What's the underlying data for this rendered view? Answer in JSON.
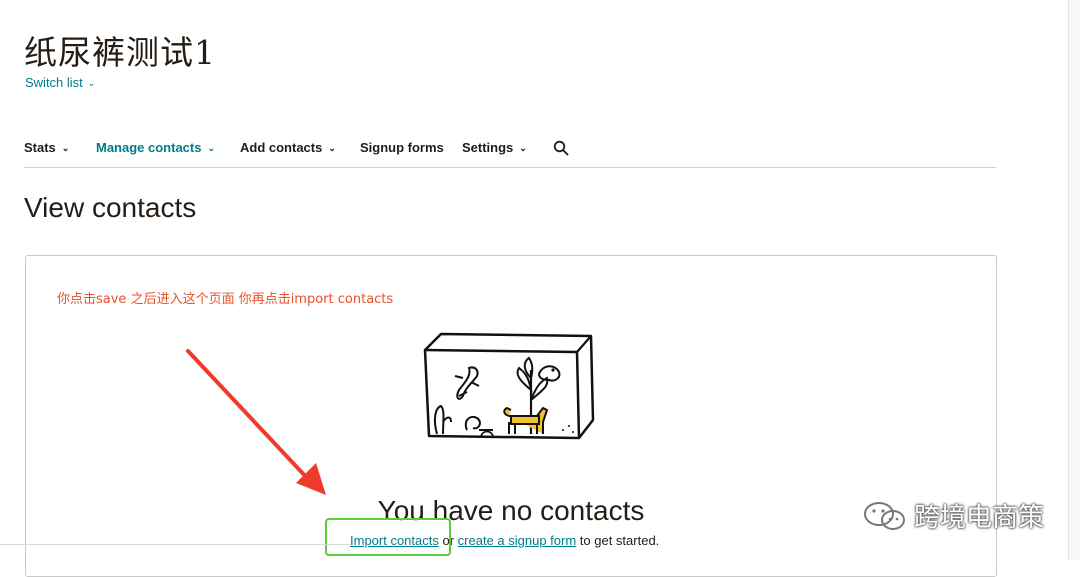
{
  "header": {
    "list_title": "纸尿裤测试1",
    "switch_list_label": "Switch list"
  },
  "nav": {
    "items": [
      {
        "label": "Stats",
        "has_dropdown": true,
        "active": false
      },
      {
        "label": "Manage contacts",
        "has_dropdown": true,
        "active": true
      },
      {
        "label": "Add contacts",
        "has_dropdown": true,
        "active": false
      },
      {
        "label": "Signup forms",
        "has_dropdown": false,
        "active": false
      },
      {
        "label": "Settings",
        "has_dropdown": true,
        "active": false
      }
    ],
    "search_icon": "search-icon"
  },
  "main": {
    "page_heading": "View contacts",
    "annotation_text": "你点击save 之后进入这个页面 你再点击import contacts",
    "empty_state": {
      "title": "You have no contacts",
      "import_link": "Import contacts",
      "or_text": " or ",
      "signup_link": "create a signup form",
      "suffix": " to get started."
    }
  },
  "watermark": {
    "text": "跨境电商策",
    "icon": "wechat-icon"
  },
  "colors": {
    "accent": "#007c89",
    "annotation": "#e8502a",
    "highlight": "#58cc3a",
    "text": "#241c15",
    "illustration_accent": "#f2c12e"
  }
}
